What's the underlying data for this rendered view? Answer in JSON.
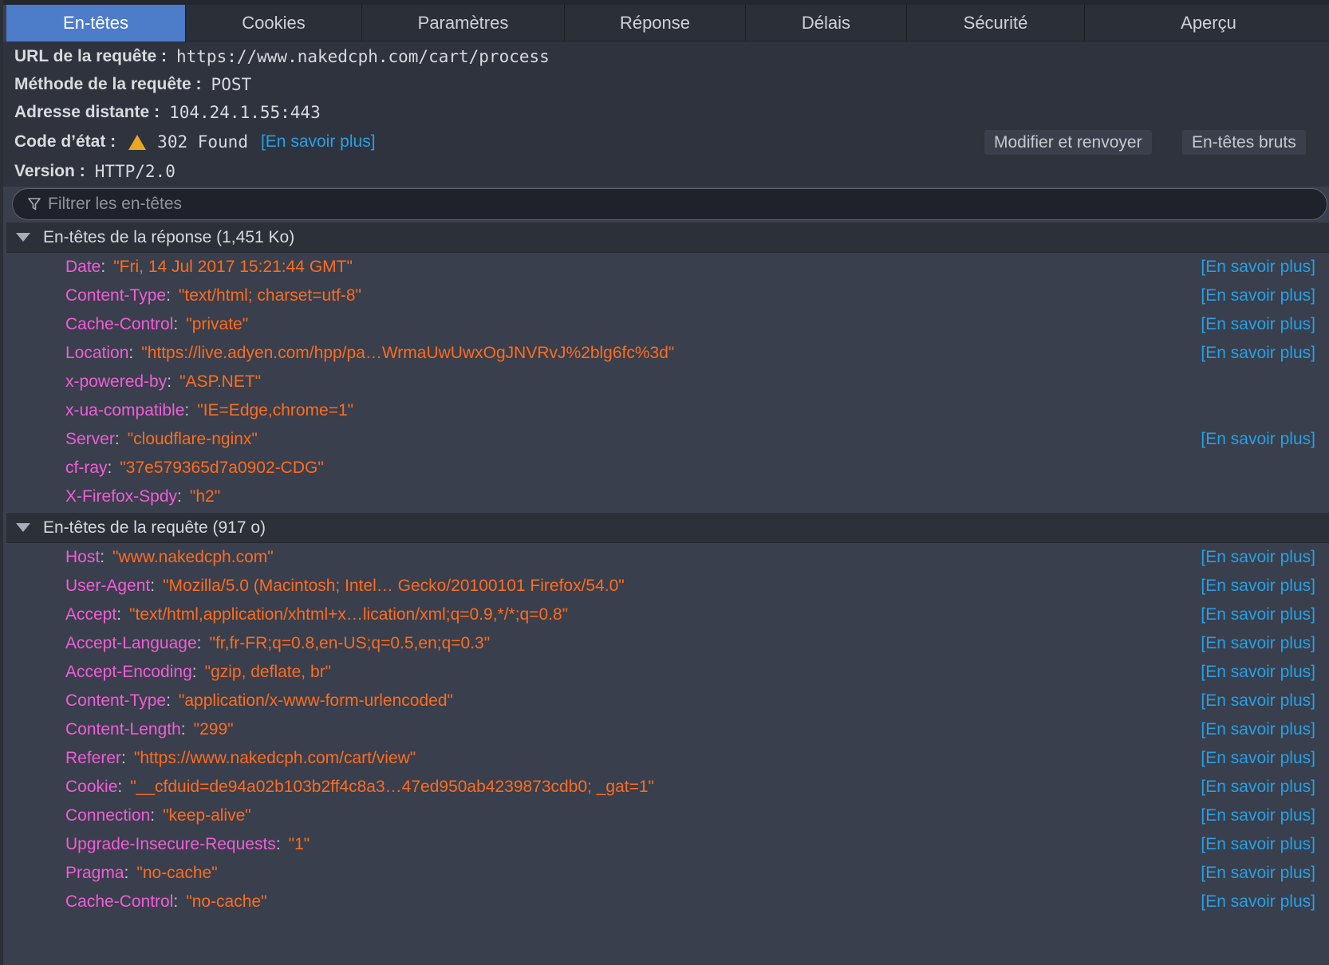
{
  "tabs": [
    "En-têtes",
    "Cookies",
    "Paramètres",
    "Réponse",
    "Délais",
    "Sécurité",
    "Aperçu"
  ],
  "summary": {
    "url_label": "URL de la requête :",
    "url_value": "https://www.nakedcph.com/cart/process",
    "method_label": "Méthode de la requête :",
    "method_value": "POST",
    "remote_label": "Adresse distante :",
    "remote_value": "104.24.1.55:443",
    "status_label": "Code d’état :",
    "status_value": "302 Found",
    "status_learn": "[En savoir plus]",
    "version_label": "Version :",
    "version_value": "HTTP/2.0"
  },
  "buttons": {
    "edit_resend": "Modifier et renvoyer",
    "raw_headers": "En-têtes bruts"
  },
  "filter": {
    "placeholder": "Filtrer les en-têtes"
  },
  "learn_more": "[En savoir plus]",
  "response_section": {
    "title": "En-têtes de la réponse (1,451 Ko)",
    "headers": [
      {
        "name": "Date",
        "value": "\"Fri, 14 Jul 2017 15:21:44 GMT\"",
        "learn": "[En savoir plus]"
      },
      {
        "name": "Content-Type",
        "value": "\"text/html; charset=utf-8\"",
        "learn": "[En savoir plus]"
      },
      {
        "name": "Cache-Control",
        "value": "\"private\"",
        "learn": "[En savoir plus]"
      },
      {
        "name": "Location",
        "value": "\"https://live.adyen.com/hpp/pa…WrmaUwUwxOgJNVRvJ%2blg6fc%3d\"",
        "learn": "[En savoir plus]"
      },
      {
        "name": "x-powered-by",
        "value": "\"ASP.NET\"",
        "learn": ""
      },
      {
        "name": "x-ua-compatible",
        "value": "\"IE=Edge,chrome=1\"",
        "learn": ""
      },
      {
        "name": "Server",
        "value": "\"cloudflare-nginx\"",
        "learn": "[En savoir plus]"
      },
      {
        "name": "cf-ray",
        "value": "\"37e579365d7a0902-CDG\"",
        "learn": ""
      },
      {
        "name": "X-Firefox-Spdy",
        "value": "\"h2\"",
        "learn": ""
      }
    ]
  },
  "request_section": {
    "title": "En-têtes de la requête (917 o)",
    "headers": [
      {
        "name": "Host",
        "value": "\"www.nakedcph.com\"",
        "learn": "[En savoir plus]"
      },
      {
        "name": "User-Agent",
        "value": "\"Mozilla/5.0 (Macintosh; Intel… Gecko/20100101 Firefox/54.0\"",
        "learn": "[En savoir plus]"
      },
      {
        "name": "Accept",
        "value": "\"text/html,application/xhtml+x…lication/xml;q=0.9,*/*;q=0.8\"",
        "learn": "[En savoir plus]"
      },
      {
        "name": "Accept-Language",
        "value": "\"fr,fr-FR;q=0.8,en-US;q=0.5,en;q=0.3\"",
        "learn": "[En savoir plus]"
      },
      {
        "name": "Accept-Encoding",
        "value": "\"gzip, deflate, br\"",
        "learn": "[En savoir plus]"
      },
      {
        "name": "Content-Type",
        "value": "\"application/x-www-form-urlencoded\"",
        "learn": "[En savoir plus]"
      },
      {
        "name": "Content-Length",
        "value": "\"299\"",
        "learn": "[En savoir plus]"
      },
      {
        "name": "Referer",
        "value": "\"https://www.nakedcph.com/cart/view\"",
        "learn": "[En savoir plus]"
      },
      {
        "name": "Cookie",
        "value": "\"__cfduid=de94a02b103b2ff4c8a3…47ed950ab4239873cdb0; _gat=1\"",
        "learn": "[En savoir plus]"
      },
      {
        "name": "Connection",
        "value": "\"keep-alive\"",
        "learn": "[En savoir plus]"
      },
      {
        "name": "Upgrade-Insecure-Requests",
        "value": "\"1\"",
        "learn": "[En savoir plus]"
      },
      {
        "name": "Pragma",
        "value": "\"no-cache\"",
        "learn": "[En savoir plus]"
      },
      {
        "name": "Cache-Control",
        "value": "\"no-cache\"",
        "learn": "[En savoir plus]"
      }
    ]
  },
  "colors": {
    "tab_active": "#4d7cc9",
    "header_name": "#f25dd8",
    "header_value": "#ff6c1f",
    "link": "#26a1e7",
    "warning": "#e9a823"
  }
}
